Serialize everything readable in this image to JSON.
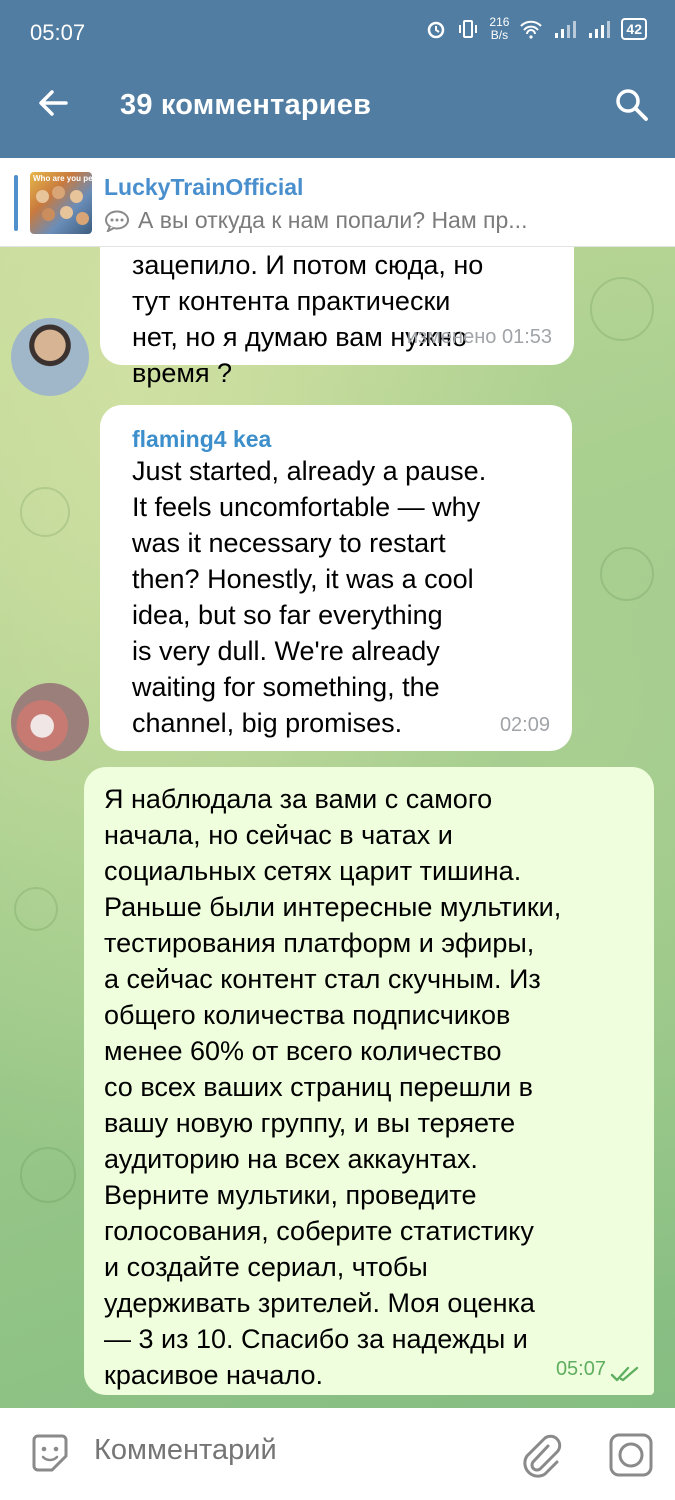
{
  "status": {
    "time": "05:07",
    "speed_value": "216",
    "speed_unit": "B/s",
    "battery": "42"
  },
  "header": {
    "title": "39 комментариев",
    "back_icon": "arrow-back-icon",
    "search_icon": "search-icon"
  },
  "pinned": {
    "name": "LuckyTrainOfficial",
    "preview": "А вы откуда к нам попали? Нам пр...",
    "thumb_caption": "Who are you people?"
  },
  "messages": [
    {
      "text": "зацепило. И потом сюда, но\nтут контента практически\nнет, но я думаю вам нужно\nвремя ?",
      "time": "изменено 01:53"
    },
    {
      "author": "flaming4 kea",
      "text": "Just started, already a pause.\nIt feels uncomfortable — why\nwas it necessary to restart\nthen? Honestly, it was a cool\nidea, but so far everything\nis very dull. We're already\nwaiting for something, the\nchannel, big promises.",
      "time": "02:09"
    },
    {
      "text": "Я наблюдала за вами с самого\nначала, но сейчас в чатах и\nсоциальных сетях царит тишина.\nРаньше были интересные мультики,\nтестирования платформ и эфиры,\nа сейчас контент стал скучным. Из\nобщего количества подписчиков\nменее 60% от всего количество\nсо всех ваших страниц перешли в\nвашу новую группу, и вы теряете\nаудиторию на всех аккаунтах.\nВерните мультики, проведите\nголосования, соберите статистику\nи создайте сериал, чтобы\nудерживать зрителей. Моя оценка\n— 3 из 10. Спасибо за надежды и\nкрасивое начало.",
      "time": "05:07"
    }
  ],
  "input": {
    "placeholder": "Комментарий"
  },
  "colors": {
    "header": "#517da2",
    "accent": "#4a8fcd",
    "outgoing_bubble": "#effedd",
    "outgoing_time": "#5fae5f"
  }
}
